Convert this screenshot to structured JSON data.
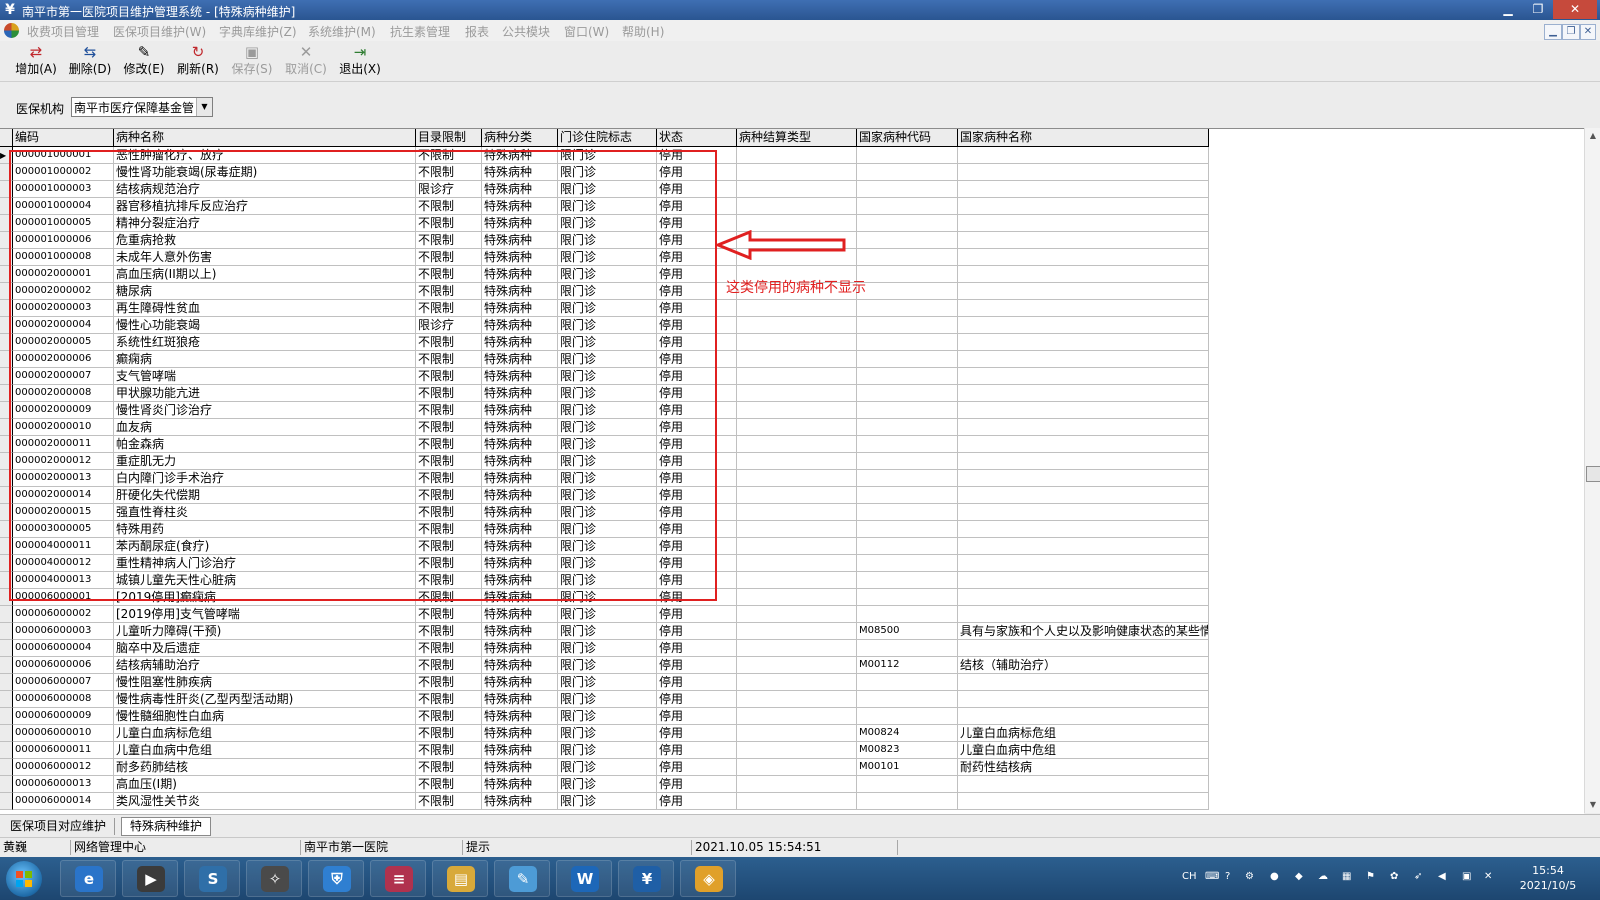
{
  "window": {
    "title": "南平市第一医院项目维护管理系统 - [特殊病种维护]",
    "icon": "yuan-icon",
    "controls": [
      "minimize-icon",
      "restore-icon",
      "close-icon"
    ]
  },
  "menu": {
    "items": [
      "收费项目管理",
      "医保项目维护(W)",
      "字典库维护(Z)",
      "系统维护(M)",
      "抗生素管理",
      "报表",
      "公共模块",
      "窗口(W)",
      "帮助(H)"
    ]
  },
  "toolbar": {
    "buttons": [
      {
        "label": "增加(A)",
        "icon": "add-icon",
        "enabled": true
      },
      {
        "label": "删除(D)",
        "icon": "delete-icon",
        "enabled": true
      },
      {
        "label": "修改(E)",
        "icon": "edit-icon",
        "enabled": true
      },
      {
        "label": "刷新(R)",
        "icon": "refresh-icon",
        "enabled": true
      },
      {
        "label": "保存(S)",
        "icon": "save-icon",
        "enabled": false
      },
      {
        "label": "取消(C)",
        "icon": "cancel-icon",
        "enabled": false
      },
      {
        "label": "退出(X)",
        "icon": "exit-icon",
        "enabled": true
      }
    ]
  },
  "filter": {
    "label": "医保机构",
    "value": "南平市医疗保障基金管"
  },
  "grid": {
    "columns": [
      "编码",
      "病种名称",
      "目录限制",
      "病种分类",
      "门诊住院标志",
      "状态",
      "病种结算类型",
      "国家病种代码",
      "国家病种名称"
    ],
    "rows": [
      [
        "000001000001",
        "恶性肿瘤化疗、放疗",
        "不限制",
        "特殊病种",
        "限门诊",
        "停用",
        "",
        "",
        ""
      ],
      [
        "000001000002",
        "慢性肾功能衰竭(尿毒症期)",
        "不限制",
        "特殊病种",
        "限门诊",
        "停用",
        "",
        "",
        ""
      ],
      [
        "000001000003",
        "结核病规范治疗",
        "限诊疗",
        "特殊病种",
        "限门诊",
        "停用",
        "",
        "",
        ""
      ],
      [
        "000001000004",
        "器官移植抗排斥反应治疗",
        "不限制",
        "特殊病种",
        "限门诊",
        "停用",
        "",
        "",
        ""
      ],
      [
        "000001000005",
        "精神分裂症治疗",
        "不限制",
        "特殊病种",
        "限门诊",
        "停用",
        "",
        "",
        ""
      ],
      [
        "000001000006",
        "危重病抢救",
        "不限制",
        "特殊病种",
        "限门诊",
        "停用",
        "",
        "",
        ""
      ],
      [
        "000001000008",
        "未成年人意外伤害",
        "不限制",
        "特殊病种",
        "限门诊",
        "停用",
        "",
        "",
        ""
      ],
      [
        "000002000001",
        "高血压病(II期以上)",
        "不限制",
        "特殊病种",
        "限门诊",
        "停用",
        "",
        "",
        ""
      ],
      [
        "000002000002",
        "糖尿病",
        "不限制",
        "特殊病种",
        "限门诊",
        "停用",
        "",
        "",
        ""
      ],
      [
        "000002000003",
        "再生障碍性贫血",
        "不限制",
        "特殊病种",
        "限门诊",
        "停用",
        "",
        "",
        ""
      ],
      [
        "000002000004",
        "慢性心功能衰竭",
        "限诊疗",
        "特殊病种",
        "限门诊",
        "停用",
        "",
        "",
        ""
      ],
      [
        "000002000005",
        "系统性红斑狼疮",
        "不限制",
        "特殊病种",
        "限门诊",
        "停用",
        "",
        "",
        ""
      ],
      [
        "000002000006",
        "癫痫病",
        "不限制",
        "特殊病种",
        "限门诊",
        "停用",
        "",
        "",
        ""
      ],
      [
        "000002000007",
        "支气管哮喘",
        "不限制",
        "特殊病种",
        "限门诊",
        "停用",
        "",
        "",
        ""
      ],
      [
        "000002000008",
        "甲状腺功能亢进",
        "不限制",
        "特殊病种",
        "限门诊",
        "停用",
        "",
        "",
        ""
      ],
      [
        "000002000009",
        "慢性肾炎门诊治疗",
        "不限制",
        "特殊病种",
        "限门诊",
        "停用",
        "",
        "",
        ""
      ],
      [
        "000002000010",
        "血友病",
        "不限制",
        "特殊病种",
        "限门诊",
        "停用",
        "",
        "",
        ""
      ],
      [
        "000002000011",
        "帕金森病",
        "不限制",
        "特殊病种",
        "限门诊",
        "停用",
        "",
        "",
        ""
      ],
      [
        "000002000012",
        "重症肌无力",
        "不限制",
        "特殊病种",
        "限门诊",
        "停用",
        "",
        "",
        ""
      ],
      [
        "000002000013",
        "白内障门诊手术治疗",
        "不限制",
        "特殊病种",
        "限门诊",
        "停用",
        "",
        "",
        ""
      ],
      [
        "000002000014",
        "肝硬化失代偿期",
        "不限制",
        "特殊病种",
        "限门诊",
        "停用",
        "",
        "",
        ""
      ],
      [
        "000002000015",
        "强直性脊柱炎",
        "不限制",
        "特殊病种",
        "限门诊",
        "停用",
        "",
        "",
        ""
      ],
      [
        "000003000005",
        "特殊用药",
        "不限制",
        "特殊病种",
        "限门诊",
        "停用",
        "",
        "",
        ""
      ],
      [
        "000004000011",
        "苯丙酮尿症(食疗)",
        "不限制",
        "特殊病种",
        "限门诊",
        "停用",
        "",
        "",
        ""
      ],
      [
        "000004000012",
        "重性精神病人门诊治疗",
        "不限制",
        "特殊病种",
        "限门诊",
        "停用",
        "",
        "",
        ""
      ],
      [
        "000004000013",
        "城镇儿童先天性心脏病",
        "不限制",
        "特殊病种",
        "限门诊",
        "停用",
        "",
        "",
        ""
      ],
      [
        "000006000001",
        "[2019停用]癫痫病",
        "不限制",
        "特殊病种",
        "限门诊",
        "停用",
        "",
        "",
        ""
      ],
      [
        "000006000002",
        "[2019停用]支气管哮喘",
        "不限制",
        "特殊病种",
        "限门诊",
        "停用",
        "",
        "",
        ""
      ],
      [
        "000006000003",
        "儿童听力障碍(干预)",
        "不限制",
        "特殊病种",
        "限门诊",
        "停用",
        "",
        "M08500",
        "具有与家族和个人史以及影响健康状态的某些情"
      ],
      [
        "000006000004",
        "脑卒中及后遗症",
        "不限制",
        "特殊病种",
        "限门诊",
        "停用",
        "",
        "",
        ""
      ],
      [
        "000006000006",
        "结核病辅助治疗",
        "不限制",
        "特殊病种",
        "限门诊",
        "停用",
        "",
        "M00112",
        "结核（辅助治疗）"
      ],
      [
        "000006000007",
        "慢性阻塞性肺疾病",
        "不限制",
        "特殊病种",
        "限门诊",
        "停用",
        "",
        "",
        ""
      ],
      [
        "000006000008",
        "慢性病毒性肝炎(乙型丙型活动期)",
        "不限制",
        "特殊病种",
        "限门诊",
        "停用",
        "",
        "",
        ""
      ],
      [
        "000006000009",
        "慢性髓细胞性白血病",
        "不限制",
        "特殊病种",
        "限门诊",
        "停用",
        "",
        "",
        ""
      ],
      [
        "000006000010",
        "儿童白血病标危组",
        "不限制",
        "特殊病种",
        "限门诊",
        "停用",
        "",
        "M00824",
        "儿童白血病标危组"
      ],
      [
        "000006000011",
        "儿童白血病中危组",
        "不限制",
        "特殊病种",
        "限门诊",
        "停用",
        "",
        "M00823",
        "儿童白血病中危组"
      ],
      [
        "000006000012",
        "耐多药肺结核",
        "不限制",
        "特殊病种",
        "限门诊",
        "停用",
        "",
        "M00101",
        "耐药性结核病"
      ],
      [
        "000006000013",
        "高血压(I期)",
        "不限制",
        "特殊病种",
        "限门诊",
        "停用",
        "",
        "",
        ""
      ],
      [
        "000006000014",
        "类风湿性关节炎",
        "不限制",
        "特殊病种",
        "限门诊",
        "停用",
        "",
        "",
        ""
      ]
    ]
  },
  "annotation": {
    "text": "这类停用的病种不显示",
    "color": "#e02020"
  },
  "bottom_tabs": [
    "医保项目对应维护",
    "特殊病种维护"
  ],
  "status": {
    "user": "黄巍",
    "department": "网络管理中心",
    "hospital": "南平市第一医院",
    "hint": "提示",
    "datetime": "2021.10.05   15:54:51"
  },
  "taskbar": {
    "apps": [
      "ie-icon",
      "media-icon",
      "s-app-icon",
      "compass-icon",
      "shield-icon",
      "database-icon",
      "folder-icon",
      "notepad-icon",
      "w-app-icon",
      "yuan-app-icon",
      "lemon-app-icon"
    ],
    "tray_lang": "CH",
    "time": "15:54",
    "date": "2021/10/5"
  },
  "colors": {
    "titlebar": "#2a5591",
    "highlight": "#e02020"
  }
}
